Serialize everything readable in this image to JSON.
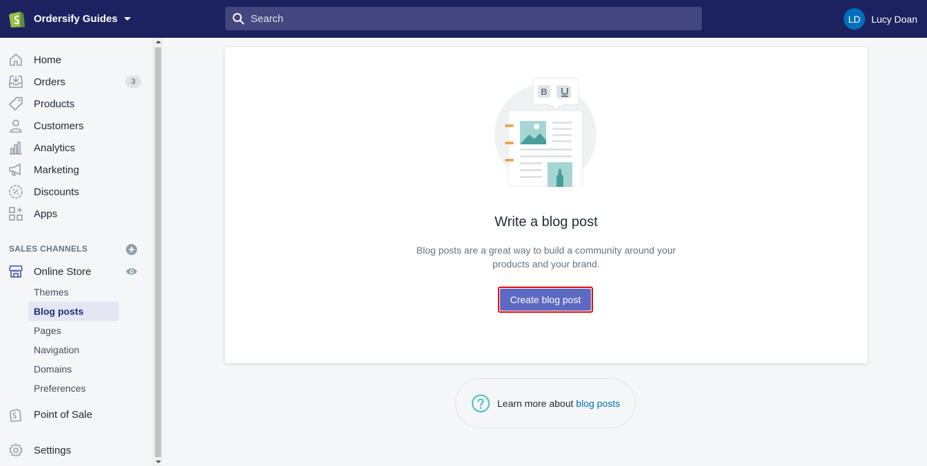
{
  "topbar": {
    "store_name": "Ordersify Guides",
    "search_placeholder": "Search",
    "user_initials": "LD",
    "user_name": "Lucy Doan"
  },
  "sidebar": {
    "items": [
      {
        "label": "Home",
        "icon": "home-icon"
      },
      {
        "label": "Orders",
        "icon": "orders-icon",
        "badge": "3"
      },
      {
        "label": "Products",
        "icon": "tag-icon"
      },
      {
        "label": "Customers",
        "icon": "person-icon"
      },
      {
        "label": "Analytics",
        "icon": "bar-chart-icon"
      },
      {
        "label": "Marketing",
        "icon": "megaphone-icon"
      },
      {
        "label": "Discounts",
        "icon": "discount-icon"
      },
      {
        "label": "Apps",
        "icon": "apps-icon"
      }
    ],
    "sales_channels_title": "SALES CHANNELS",
    "online_store_label": "Online Store",
    "online_store_subitems": [
      "Themes",
      "Blog posts",
      "Pages",
      "Navigation",
      "Domains",
      "Preferences"
    ],
    "active_subitem": "Blog posts",
    "point_of_sale_label": "Point of Sale",
    "settings_label": "Settings"
  },
  "main": {
    "empty_state_title": "Write a blog post",
    "empty_state_description": "Blog posts are a great way to build a community around your products and your brand.",
    "cta_label": "Create blog post",
    "learn_more_prefix": "Learn more about ",
    "learn_more_link": "blog posts"
  },
  "colors": {
    "topbar": "#1c2260",
    "primary_button": "#5c6ac4",
    "highlight_border": "#ee0000",
    "link": "#006fbb"
  }
}
